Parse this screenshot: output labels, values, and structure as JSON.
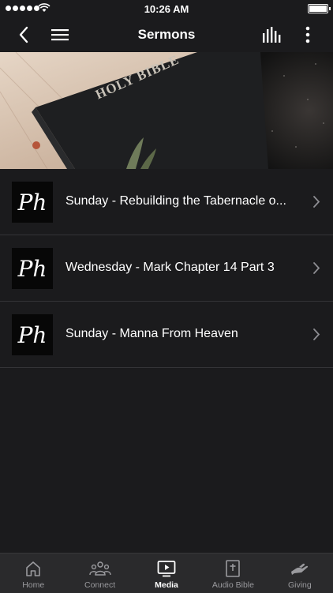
{
  "status_bar": {
    "time": "10:26 AM"
  },
  "nav": {
    "title": "Sermons"
  },
  "hero": {
    "text": "HOLY BIBLE"
  },
  "sermons": [
    {
      "title": "Sunday - Rebuilding the Tabernacle o...",
      "logo": "Ph"
    },
    {
      "title": "Wednesday - Mark Chapter 14 Part 3",
      "logo": "Ph"
    },
    {
      "title": "Sunday - Manna From Heaven",
      "logo": "Ph"
    }
  ],
  "tabs": [
    {
      "label": "Home",
      "icon": "home-icon",
      "active": false
    },
    {
      "label": "Connect",
      "icon": "people-icon",
      "active": false
    },
    {
      "label": "Media",
      "icon": "play-icon",
      "active": true
    },
    {
      "label": "Audio Bible",
      "icon": "bible-icon",
      "active": false
    },
    {
      "label": "Giving",
      "icon": "giving-hand-icon",
      "active": false
    }
  ],
  "colors": {
    "background": "#1b1b1d",
    "tabbar": "#2a2a2c",
    "divider": "#343437"
  }
}
